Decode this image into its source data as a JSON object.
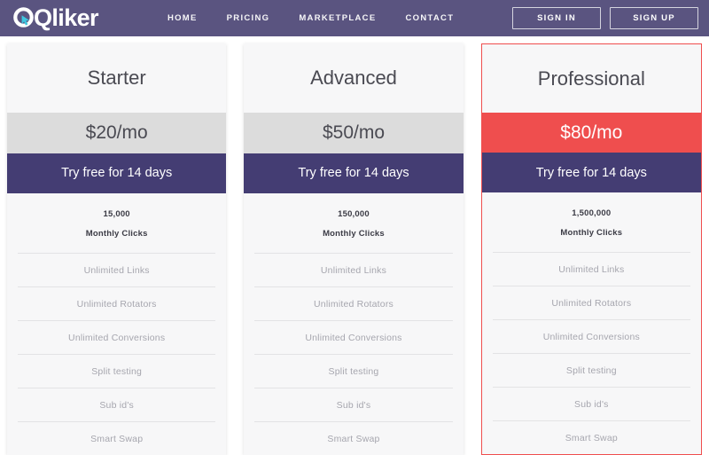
{
  "brand": {
    "name": "Qliker",
    "logo_mark": "q-cursor-icon",
    "bar_color": "#5a5480",
    "accent_color": "#ef4e4e",
    "cta_color": "#443d73"
  },
  "nav": {
    "links": [
      {
        "label": "HOME"
      },
      {
        "label": "PRICING"
      },
      {
        "label": "MARKETPLACE"
      },
      {
        "label": "CONTACT"
      }
    ],
    "sign_in_label": "SIGN IN",
    "sign_up_label": "SIGN UP"
  },
  "pricing": {
    "cta_label": "Try free for 14 days",
    "quota_label": "Monthly Clicks",
    "plans": [
      {
        "name": "Starter",
        "price": "$20/mo",
        "quota": "15,000",
        "quota_label": "Monthly Clicks",
        "cta": "Try free for 14 days",
        "featured": false,
        "features": [
          "Unlimited Links",
          "Unlimited Rotators",
          "Unlimited Conversions",
          "Split testing",
          "Sub id's",
          "Smart Swap"
        ]
      },
      {
        "name": "Advanced",
        "price": "$50/mo",
        "quota": "150,000",
        "quota_label": "Monthly Clicks",
        "cta": "Try free for 14 days",
        "featured": false,
        "features": [
          "Unlimited Links",
          "Unlimited Rotators",
          "Unlimited Conversions",
          "Split testing",
          "Sub id's",
          "Smart Swap"
        ]
      },
      {
        "name": "Professional",
        "price": "$80/mo",
        "quota": "1,500,000",
        "quota_label": "Monthly Clicks",
        "cta": "Try free for 14 days",
        "featured": true,
        "features": [
          "Unlimited Links",
          "Unlimited Rotators",
          "Unlimited Conversions",
          "Split testing",
          "Sub id's",
          "Smart Swap"
        ]
      }
    ]
  }
}
